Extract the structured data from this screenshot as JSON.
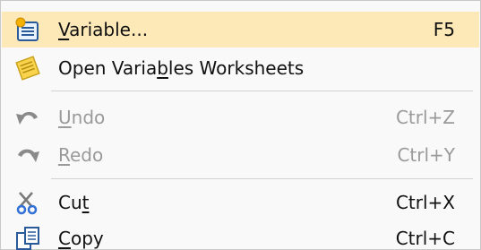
{
  "menu": {
    "items": [
      {
        "pre": "",
        "mn": "V",
        "post": "ariable...",
        "shortcut": "F5",
        "icon": "variable-icon",
        "enabled": true,
        "highlighted": true
      },
      {
        "pre": "Open Varia",
        "mn": "b",
        "post": "les Worksheets",
        "shortcut": "",
        "icon": "worksheets-icon",
        "enabled": true,
        "highlighted": false
      },
      {
        "pre": "",
        "mn": "U",
        "post": "ndo",
        "shortcut": "Ctrl+Z",
        "icon": "undo-icon",
        "enabled": false,
        "highlighted": false
      },
      {
        "pre": "",
        "mn": "R",
        "post": "edo",
        "shortcut": "Ctrl+Y",
        "icon": "redo-icon",
        "enabled": false,
        "highlighted": false
      },
      {
        "pre": "Cu",
        "mn": "t",
        "post": "",
        "shortcut": "Ctrl+X",
        "icon": "scissors-icon",
        "enabled": true,
        "highlighted": false
      },
      {
        "pre": "",
        "mn": "C",
        "post": "opy",
        "shortcut": "Ctrl+C",
        "icon": "copy-icon",
        "enabled": true,
        "highlighted": false
      }
    ]
  },
  "colors": {
    "highlight": "#fde9b8",
    "disabled_text": "#9a9a9a",
    "separator": "#d2d2d2"
  }
}
